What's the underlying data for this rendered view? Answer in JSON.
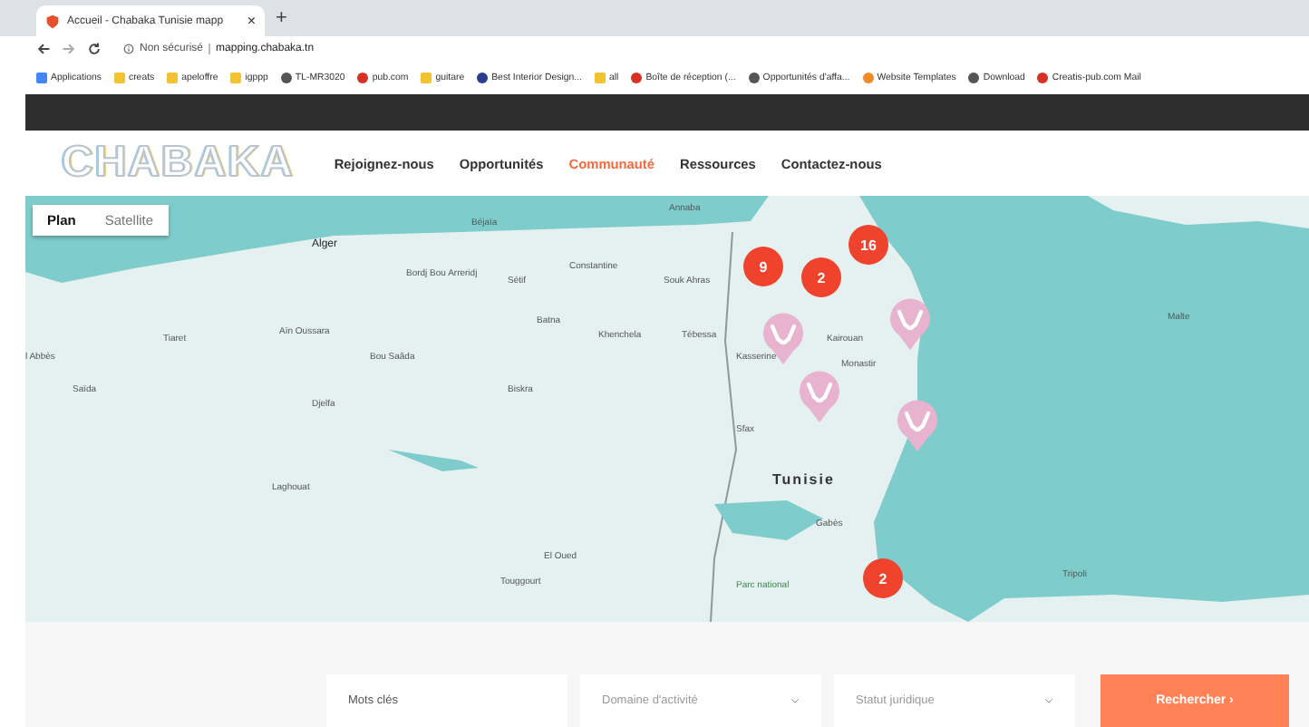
{
  "browser": {
    "tab_title": "Accueil - Chabaka Tunisie mapp",
    "tab_close": "×",
    "new_tab": "+",
    "security": "Non sécurisé",
    "url": "mapping.chabaka.tn",
    "bookmarks": [
      {
        "label": "Applications",
        "kind": "apps"
      },
      {
        "label": "creats",
        "kind": "folder"
      },
      {
        "label": "apeloffre",
        "kind": "folder"
      },
      {
        "label": "igppp",
        "kind": "folder"
      },
      {
        "label": "TL-MR3020",
        "kind": "globe"
      },
      {
        "label": "pub.com",
        "kind": "mail"
      },
      {
        "label": "guitare",
        "kind": "folder"
      },
      {
        "label": "Best Interior Design...",
        "kind": "crown"
      },
      {
        "label": "all",
        "kind": "folder"
      },
      {
        "label": "Boîte de réception (...",
        "kind": "mail"
      },
      {
        "label": "Opportunités d'affa...",
        "kind": "globe"
      },
      {
        "label": "Website Templates",
        "kind": "orange"
      },
      {
        "label": "Download",
        "kind": "globe"
      },
      {
        "label": "Creatis-pub.com Mail",
        "kind": "mail"
      }
    ]
  },
  "header": {
    "logo": "CHABAKA",
    "nav": [
      {
        "label": "Rejoignez-nous",
        "selected": false
      },
      {
        "label": "Opportunités",
        "selected": false
      },
      {
        "label": "Communauté",
        "selected": true
      },
      {
        "label": "Ressources",
        "selected": false
      },
      {
        "label": "Contactez-nous",
        "selected": false
      }
    ]
  },
  "map": {
    "map_types": [
      {
        "label": "Plan",
        "selected": true
      },
      {
        "label": "Satellite",
        "selected": false
      }
    ],
    "places": [
      {
        "name": "Alger",
        "kind": "capital"
      },
      {
        "name": "Béjaïa",
        "kind": "city"
      },
      {
        "name": "Annaba",
        "kind": "city"
      },
      {
        "name": "Bordj Bou Arreridj",
        "kind": "city"
      },
      {
        "name": "Sétif",
        "kind": "city"
      },
      {
        "name": "Constantine",
        "kind": "city"
      },
      {
        "name": "Souk Ahras",
        "kind": "city"
      },
      {
        "name": "Tiaret",
        "kind": "city"
      },
      {
        "name": "Aïn Oussara",
        "kind": "city"
      },
      {
        "name": "Bou Saâda",
        "kind": "city"
      },
      {
        "name": "Batna",
        "kind": "city"
      },
      {
        "name": "Khenchela",
        "kind": "city"
      },
      {
        "name": "Tébessa",
        "kind": "city"
      },
      {
        "name": "Kasserine",
        "kind": "city"
      },
      {
        "name": "Kairouan",
        "kind": "city"
      },
      {
        "name": "Monastir",
        "kind": "city"
      },
      {
        "name": "l Abbès",
        "kind": "city"
      },
      {
        "name": "Saïda",
        "kind": "city"
      },
      {
        "name": "Biskra",
        "kind": "city"
      },
      {
        "name": "Djelfa",
        "kind": "city"
      },
      {
        "name": "Sfax",
        "kind": "city"
      },
      {
        "name": "Laghouat",
        "kind": "city"
      },
      {
        "name": "Tunisie",
        "kind": "country"
      },
      {
        "name": "Gabès",
        "kind": "city"
      },
      {
        "name": "Malte",
        "kind": "city"
      },
      {
        "name": "Tripoli",
        "kind": "city"
      },
      {
        "name": "El Oued",
        "kind": "city"
      },
      {
        "name": "Touggourt",
        "kind": "city"
      },
      {
        "name": "Parc national",
        "kind": "park"
      }
    ],
    "clusters": [
      {
        "count": "9"
      },
      {
        "count": "2"
      },
      {
        "count": "16"
      },
      {
        "count": "2"
      }
    ],
    "pins": [
      {
        "kind": "hands"
      },
      {
        "kind": "hands"
      },
      {
        "kind": "hands"
      },
      {
        "kind": "hands"
      }
    ]
  },
  "search": {
    "keywords_placeholder": "Mots clés",
    "selects": [
      {
        "placeholder": "Domaine d'activité"
      },
      {
        "placeholder": "Statut juridique"
      }
    ],
    "button": "Rechercher",
    "button_arrow": "›"
  }
}
